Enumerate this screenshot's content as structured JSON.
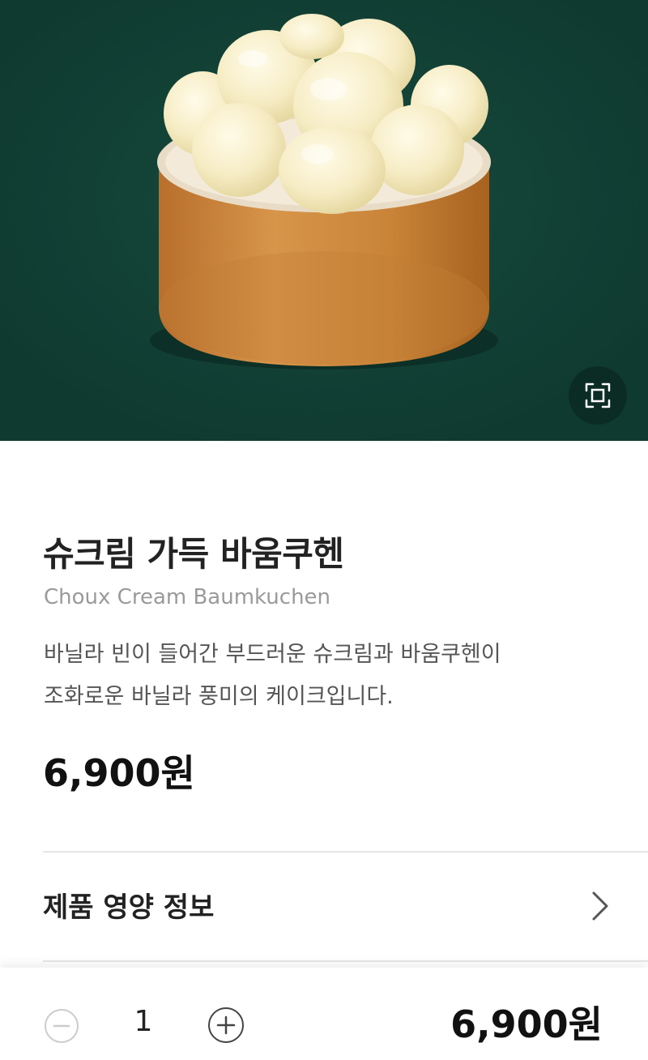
{
  "product": {
    "image_alt": "cake-photo",
    "name_ko": "슈크림 가득 바움쿠헨",
    "name_en": "Choux Cream Baumkuchen",
    "description_line1": "바닐라 빈이 들어간 부드러운 슈크림과 바움쿠헨이",
    "description_line2": "조화로운 바닐라 풍미의 케이크입니다.",
    "price": "6,900원"
  },
  "nutrition": {
    "label": "제품 영양 정보"
  },
  "order": {
    "quantity": "1",
    "total_price": "6,900원"
  },
  "icons": {
    "zoom": "expand-icon",
    "chevron": "chevron-right-icon",
    "minus": "minus-circle-icon",
    "plus": "plus-circle-icon"
  },
  "colors": {
    "hero_background": "#0f3a30",
    "text_primary": "#222222",
    "text_secondary": "#9a9a9a",
    "divider": "#e6e6e6"
  }
}
